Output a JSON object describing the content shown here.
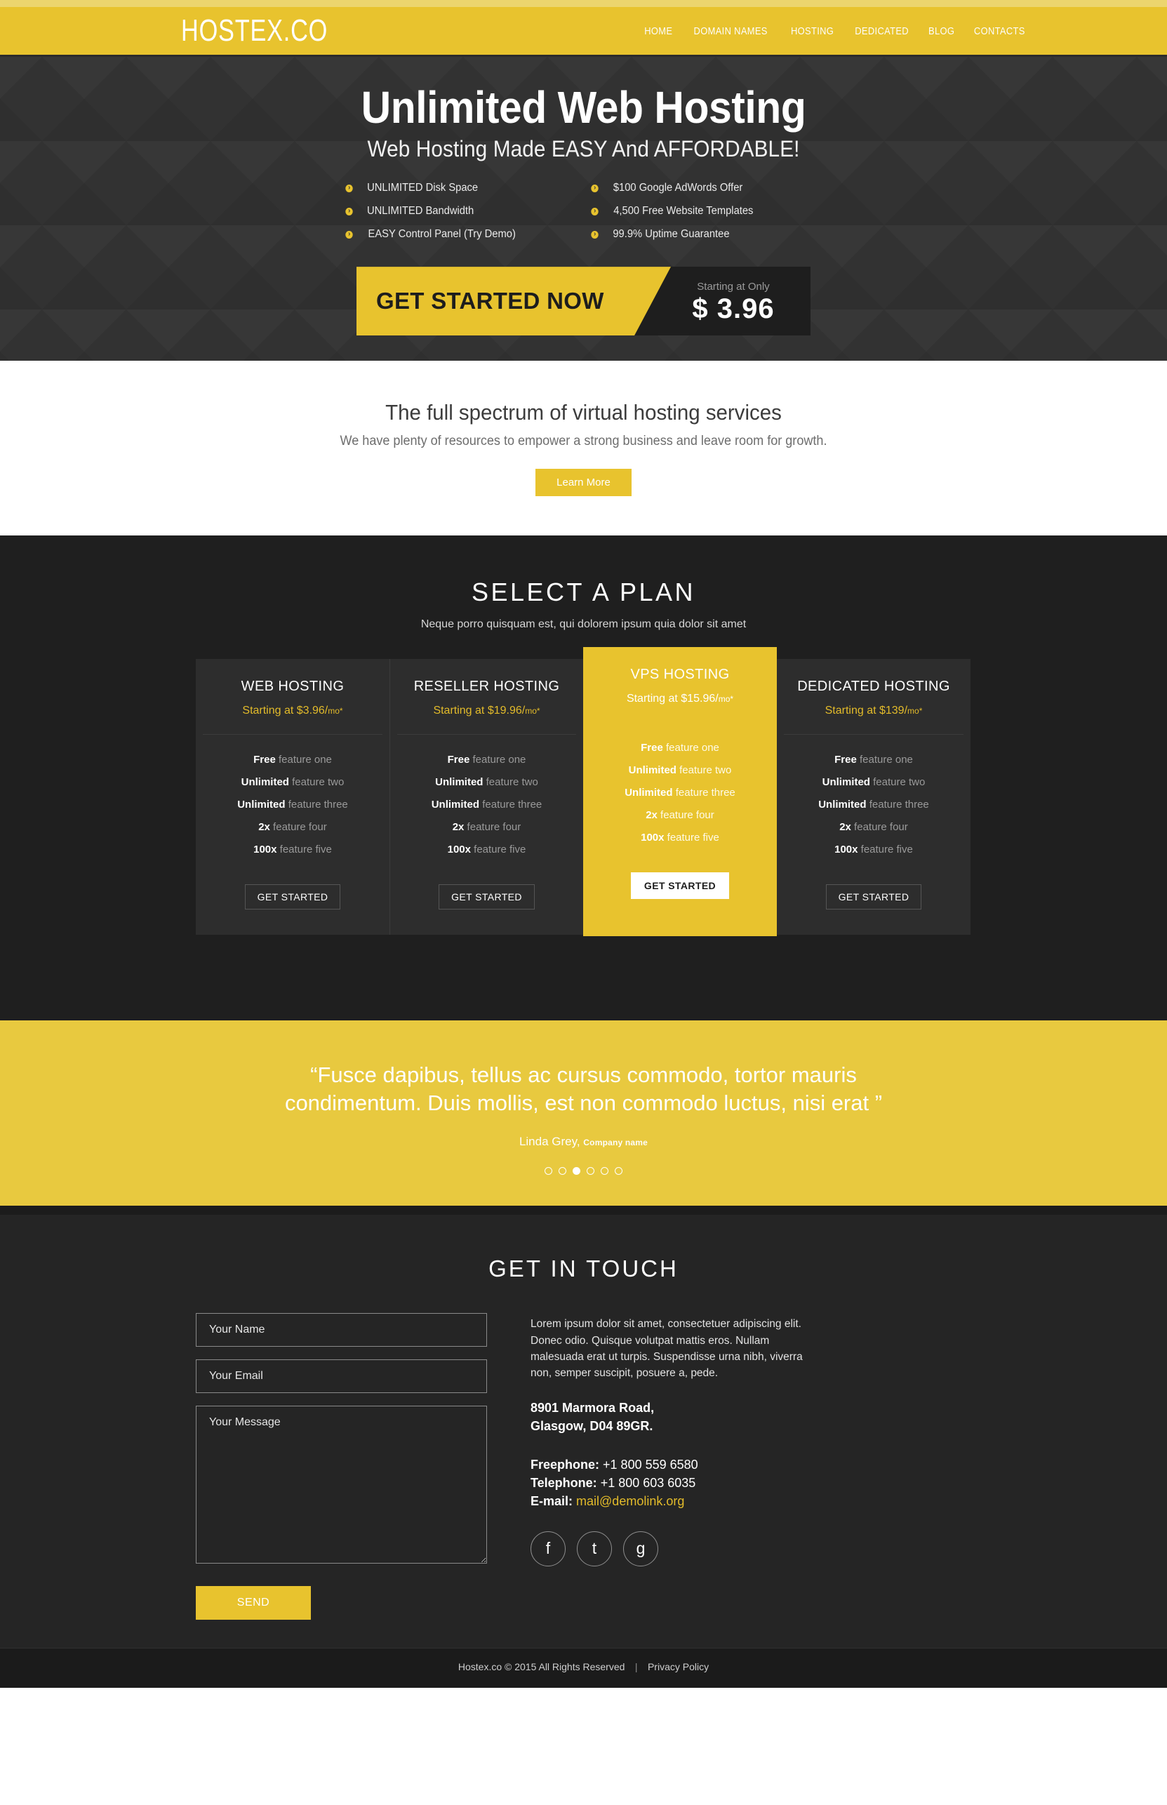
{
  "topbar": {
    "logo": "HOSTEX.CO"
  },
  "nav": {
    "items": [
      {
        "label": "HOME"
      },
      {
        "label": "DOMAIN NAMES"
      },
      {
        "label": "HOSTING"
      },
      {
        "label": "DEDICATED"
      },
      {
        "label": "BLOG"
      },
      {
        "label": "CONTACTS"
      }
    ]
  },
  "hero": {
    "title": "Unlimited Web Hosting",
    "subtitle": "Web Hosting Made EASY And AFFORDABLE!",
    "features_left": [
      "UNLIMITED Disk Space",
      "UNLIMITED Bandwidth",
      "EASY Control Panel (Try Demo)"
    ],
    "features_right": [
      "$100 Google AdWords Offer",
      "4,500 Free Website Templates",
      "99.9% Uptime Guarantee"
    ],
    "cta_label": "GET STARTED NOW",
    "cta_caption": "Starting at Only",
    "cta_price": "$ 3.96"
  },
  "intro": {
    "heading": "The full spectrum of virtual hosting services",
    "text": "We have plenty of resources to empower a strong business and leave room for growth.",
    "button": "Learn More"
  },
  "plans": {
    "heading": "SELECT A PLAN",
    "subheading": "Neque porro quisquam est, qui dolorem ipsum quia dolor sit amet",
    "items": [
      {
        "title": "WEB HOSTING",
        "price_prefix": "Starting at $3.96/",
        "price_unit": "mo*",
        "featured": false,
        "button": "GET STARTED",
        "features": [
          {
            "strong": "Free",
            "rest": " feature one"
          },
          {
            "strong": "Unlimited",
            "rest": " feature two"
          },
          {
            "strong": "Unlimited",
            "rest": " feature three"
          },
          {
            "strong": "2x",
            "rest": " feature four"
          },
          {
            "strong": "100x",
            "rest": " feature five"
          }
        ]
      },
      {
        "title": "RESELLER HOSTING",
        "price_prefix": "Starting at $19.96/",
        "price_unit": "mo*",
        "featured": false,
        "button": "GET STARTED",
        "features": [
          {
            "strong": "Free",
            "rest": " feature one"
          },
          {
            "strong": "Unlimited",
            "rest": " feature two"
          },
          {
            "strong": "Unlimited",
            "rest": " feature three"
          },
          {
            "strong": "2x",
            "rest": " feature four"
          },
          {
            "strong": "100x",
            "rest": " feature five"
          }
        ]
      },
      {
        "title": "VPS HOSTING",
        "price_prefix": "Starting at $15.96/",
        "price_unit": "mo*",
        "featured": true,
        "button": "GET STARTED",
        "features": [
          {
            "strong": "Free",
            "rest": " feature one"
          },
          {
            "strong": "Unlimited",
            "rest": " feature two"
          },
          {
            "strong": "Unlimited",
            "rest": " feature three"
          },
          {
            "strong": "2x",
            "rest": " feature four"
          },
          {
            "strong": "100x",
            "rest": " feature five"
          }
        ]
      },
      {
        "title": "DEDICATED HOSTING",
        "price_prefix": "Starting at $139/",
        "price_unit": "mo*",
        "featured": false,
        "button": "GET STARTED",
        "features": [
          {
            "strong": "Free",
            "rest": " feature one"
          },
          {
            "strong": "Unlimited",
            "rest": " feature two"
          },
          {
            "strong": "Unlimited",
            "rest": " feature three"
          },
          {
            "strong": "2x",
            "rest": " feature four"
          },
          {
            "strong": "100x",
            "rest": " feature five"
          }
        ]
      }
    ]
  },
  "testimonial": {
    "quote": "“Fusce dapibus, tellus ac cursus commodo, tortor mauris condimentum. Duis mollis, est non commodo luctus, nisi erat ”",
    "author_name": "Linda Grey,",
    "author_company": "Company name",
    "dots_total": 6,
    "dot_active_index": 2
  },
  "contact": {
    "heading": "GET IN TOUCH",
    "name_placeholder": "Your Name",
    "email_placeholder": "Your Email",
    "message_placeholder": "Your Message",
    "send_label": "SEND",
    "lead": "Lorem ipsum dolor sit amet, consectetuer adipiscing elit. Donec odio. Quisque volutpat mattis eros. Nullam malesuada erat ut turpis. Suspendisse urna nibh, viverra non, semper suscipit, posuere a, pede.",
    "address_line1": "8901 Marmora Road,",
    "address_line2": "Glasgow, D04 89GR.",
    "freephone_label": "Freephone:",
    "freephone_value": "+1 800 559 6580",
    "telephone_label": "Telephone:",
    "telephone_value": "+1 800 603 6035",
    "email_label": "E-mail:",
    "email_value": "mail@demolink.org",
    "socials": [
      {
        "glyph": "f"
      },
      {
        "glyph": "t"
      },
      {
        "glyph": "g"
      }
    ]
  },
  "footer": {
    "copyright": "Hostex.co © 2015 All Rights Reserved",
    "divider": "|",
    "privacy": "Privacy Policy"
  },
  "colors": {
    "brand_yellow": "#e8c32e",
    "testimonial_yellow": "#e8c93f",
    "dark": "#252525",
    "hero_dark": "#323232"
  }
}
